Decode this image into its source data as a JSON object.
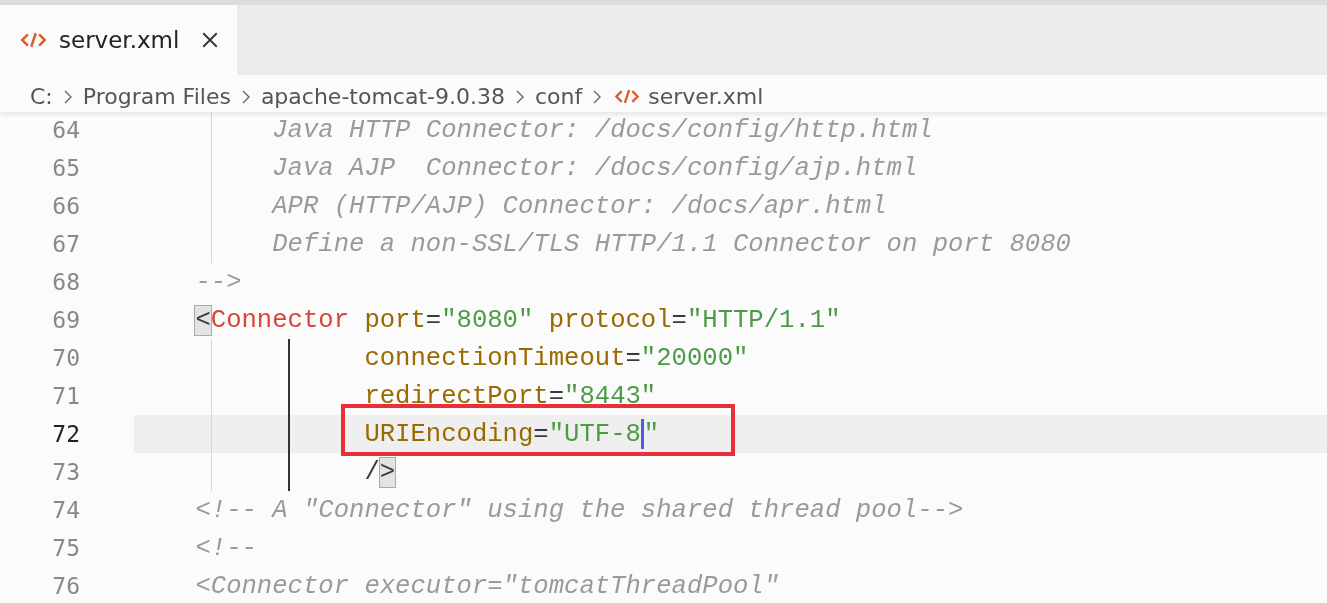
{
  "tabs": [
    {
      "label": "server.xml",
      "selected": true,
      "kind": "xml"
    }
  ],
  "breadcrumbs": [
    {
      "label": "C:",
      "kind": "folder"
    },
    {
      "label": "Program Files",
      "kind": "folder"
    },
    {
      "label": "apache-tomcat-9.0.38",
      "kind": "folder"
    },
    {
      "label": "conf",
      "kind": "folder"
    },
    {
      "label": "server.xml",
      "kind": "xml"
    }
  ],
  "lines": [
    {
      "number": "64",
      "current": false,
      "boxed": false,
      "tokens": [
        {
          "kind": "comment",
          "text": "         Java HTTP Connector: /docs/config/http.html"
        }
      ]
    },
    {
      "number": "65",
      "current": false,
      "boxed": false,
      "tokens": [
        {
          "kind": "comment",
          "text": "         Java AJP  Connector: /docs/config/ajp.html"
        }
      ]
    },
    {
      "number": "66",
      "current": false,
      "boxed": false,
      "tokens": [
        {
          "kind": "comment",
          "text": "         APR (HTTP/AJP) Connector: /docs/apr.html"
        }
      ]
    },
    {
      "number": "67",
      "current": false,
      "boxed": false,
      "tokens": [
        {
          "kind": "comment",
          "text": "         Define a non-SSL/TLS HTTP/1.1 Connector on port 8080"
        }
      ]
    },
    {
      "number": "68",
      "current": false,
      "boxed": false,
      "tokens": [
        {
          "kind": "comment",
          "text": "    -->"
        }
      ]
    },
    {
      "number": "69",
      "current": false,
      "boxed": false,
      "tokens": [
        {
          "kind": "punct",
          "text": "    <",
          "matched": true
        },
        {
          "kind": "tag",
          "text": "Connector"
        },
        {
          "kind": "attr",
          "text": " port"
        },
        {
          "kind": "punct",
          "text": "="
        },
        {
          "kind": "string",
          "text": "\"8080\""
        },
        {
          "kind": "attr",
          "text": " protocol"
        },
        {
          "kind": "punct",
          "text": "="
        },
        {
          "kind": "string",
          "text": "\"HTTP/1.1\""
        }
      ]
    },
    {
      "number": "70",
      "current": false,
      "boxed": false,
      "tokens": [
        {
          "kind": "attr",
          "text": "               connectionTimeout"
        },
        {
          "kind": "punct",
          "text": "="
        },
        {
          "kind": "string",
          "text": "\"20000\""
        }
      ]
    },
    {
      "number": "71",
      "current": false,
      "boxed": false,
      "tokens": [
        {
          "kind": "attr",
          "text": "               redirectPort"
        },
        {
          "kind": "punct",
          "text": "="
        },
        {
          "kind": "string",
          "text": "\"8443\""
        }
      ]
    },
    {
      "number": "72",
      "current": true,
      "boxed": true,
      "tokens": [
        {
          "kind": "attr",
          "text": "               URIEncoding"
        },
        {
          "kind": "punct",
          "text": "="
        },
        {
          "kind": "string",
          "text": "\"UTF-8",
          "caret": true
        },
        {
          "kind": "string",
          "text": "\""
        }
      ]
    },
    {
      "number": "73",
      "current": false,
      "boxed": false,
      "tokens": [
        {
          "kind": "punct",
          "text": "               /"
        },
        {
          "kind": "punct",
          "text": ">",
          "matched": true
        }
      ]
    },
    {
      "number": "74",
      "current": false,
      "boxed": false,
      "tokens": [
        {
          "kind": "comment",
          "text": "    <!-- A \"Connector\" using the shared thread pool-->"
        }
      ]
    },
    {
      "number": "75",
      "current": false,
      "boxed": false,
      "tokens": [
        {
          "kind": "comment",
          "text": "    <!--"
        }
      ]
    },
    {
      "number": "76",
      "current": false,
      "boxed": false,
      "tokens": [
        {
          "kind": "comment",
          "text": "    <Connector executor=\"tomcatThreadPool\""
        }
      ]
    }
  ]
}
